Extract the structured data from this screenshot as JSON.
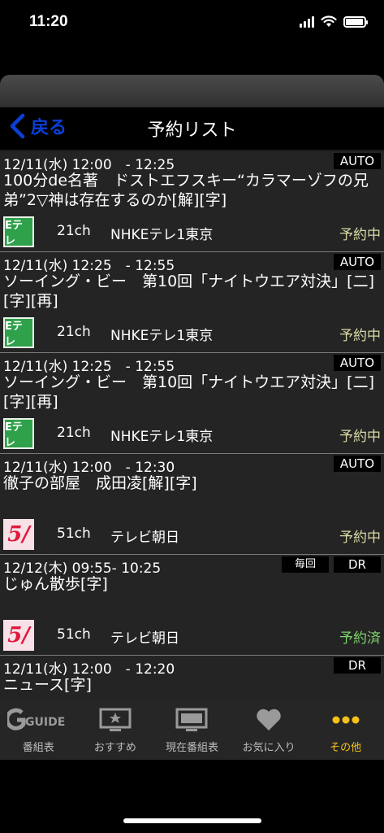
{
  "status_bar": {
    "time": "11:20",
    "battery_level": 0.95
  },
  "nav": {
    "back_label": "戻る",
    "title": "予約リスト"
  },
  "colors": {
    "accent": "#0a3fd8",
    "status_reserving": "#d9d9a6",
    "status_reserved": "#7ed36b",
    "tab_active": "#f5c21b"
  },
  "reservations": [
    {
      "time": "12/11(水) 12:00　- 12:25",
      "badges": [
        "AUTO"
      ],
      "title": "100分de名著　ドストエフスキー“カラマーゾフの兄弟”2▽神は存在するのか[解][字]",
      "logo": "Eテレ",
      "logo_type": "etele",
      "channel": "21ch",
      "station": "NHKEテレ1東京",
      "status": "予約中",
      "status_kind": "reserving"
    },
    {
      "time": "12/11(水) 12:25　- 12:55",
      "badges": [
        "AUTO"
      ],
      "title": "ソーイング・ビー　第10回「ナイトウエア対決」[二][字][再]",
      "logo": "Eテレ",
      "logo_type": "etele",
      "channel": "21ch",
      "station": "NHKEテレ1東京",
      "status": "予約中",
      "status_kind": "reserving"
    },
    {
      "time": "12/11(水) 12:25　- 12:55",
      "badges": [
        "AUTO"
      ],
      "title": "ソーイング・ビー　第10回「ナイトウエア対決」[二][字][再]",
      "logo": "Eテレ",
      "logo_type": "etele",
      "channel": "21ch",
      "station": "NHKEテレ1東京",
      "status": "予約中",
      "status_kind": "reserving"
    },
    {
      "time": "12/11(水) 12:00　- 12:30",
      "badges": [
        "AUTO"
      ],
      "title": "徹子の部屋　成田凌[解][字]",
      "logo": "5/",
      "logo_type": "asahi",
      "channel": "51ch",
      "station": "テレビ朝日",
      "status": "予約中",
      "status_kind": "reserving"
    },
    {
      "time": "12/12(木) 09:55- 10:25",
      "badges": [
        "毎回",
        "DR"
      ],
      "title": "じゅん散歩[字]",
      "logo": "5/",
      "logo_type": "asahi",
      "channel": "51ch",
      "station": "テレビ朝日",
      "status": "予約済",
      "status_kind": "reserved"
    },
    {
      "time": "12/11(水) 12:00　- 12:20",
      "badges": [
        "DR"
      ],
      "title": "ニュース[字]",
      "logo": "",
      "logo_type": "none",
      "channel": "",
      "station": "",
      "status": "",
      "status_kind": "none"
    }
  ],
  "tabs": [
    {
      "label": "番組表",
      "icon": "gguide-logo-icon",
      "logo_text": "GUIDE",
      "active": false
    },
    {
      "label": "おすすめ",
      "icon": "tv-star-icon",
      "active": false
    },
    {
      "label": "現在番組表",
      "icon": "tv-icon",
      "active": false
    },
    {
      "label": "お気に入り",
      "icon": "heart-icon",
      "active": false
    },
    {
      "label": "その他",
      "icon": "more-dots-icon",
      "active": true
    }
  ]
}
